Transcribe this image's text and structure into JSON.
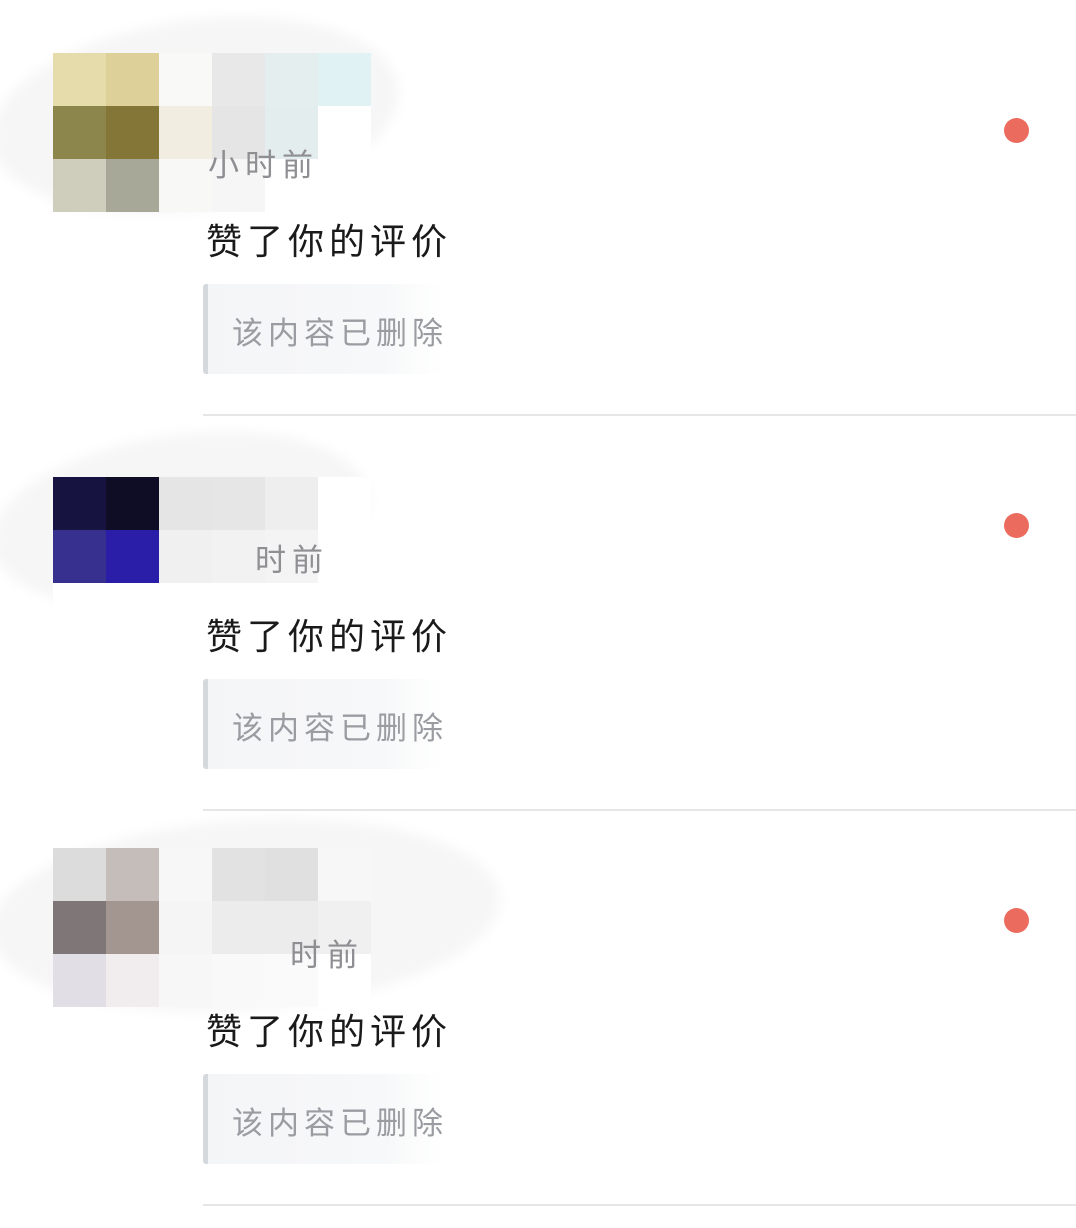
{
  "notifications": [
    {
      "time_text": "小时前",
      "action_text": "赞了你的评价",
      "quoted_text": "该内容已删除",
      "unread": true,
      "unread_color": "#eb6b5e",
      "avatar_icon": "avatar-icon",
      "mosaic_colors": [
        "#e6dcab",
        "#ddd199",
        "#f9f9f7",
        "#e8e8e8",
        "#e4eeee",
        "#e0f2f3",
        "#8c854c",
        "#847637",
        "#f1ede1",
        "#e5e5e5",
        "#e3eded",
        "#ffffff",
        "#cfcdbb",
        "#a8a899",
        "#f8f8f6",
        "#f6f6f6",
        "#ffffff",
        "#ffffff"
      ]
    },
    {
      "time_text": "时前",
      "action_text": "赞了你的评价",
      "quoted_text": "该内容已删除",
      "unread": true,
      "unread_color": "#eb6b5e",
      "avatar_icon": "avatar-icon",
      "mosaic_colors": [
        "#171340",
        "#0f0d26",
        "#e5e5e5",
        "#e6e6e6",
        "#eeeeee",
        "#ffffff",
        "#38308e",
        "#2a1ea8",
        "#f0f0f1",
        "#f2f2f2",
        "#f4f4f4",
        "#ffffff",
        "#ffffff",
        "#ffffff",
        "#ffffff",
        "#ffffff",
        "#ffffff",
        "#ffffff"
      ]
    },
    {
      "time_text": "时前",
      "action_text": "赞了你的评价",
      "quoted_text": "该内容已删除",
      "unread": true,
      "unread_color": "#eb6b5e",
      "avatar_icon": "avatar-icon",
      "mosaic_colors": [
        "#dddcdd",
        "#c4bdb9",
        "#f7f7f7",
        "#e2e2e2",
        "#e0e0e0",
        "#f7f7f7",
        "#7f7678",
        "#a3958f",
        "#f5f5f5",
        "#ececec",
        "#ececec",
        "#f0f0f0",
        "#e2dee6",
        "#f1eced",
        "#f7f7f7",
        "#f9f9f9",
        "#fafafa",
        "#ffffff"
      ]
    }
  ]
}
